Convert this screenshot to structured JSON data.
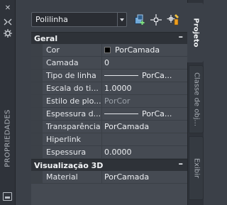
{
  "palette": {
    "title": "PROPRIEDADES"
  },
  "toolbar": {
    "object_type": "Polilinha",
    "buttons": [
      {
        "name": "toggle-pickadd-button",
        "icon": "pickadd-icon"
      },
      {
        "name": "select-objects-button",
        "icon": "crosshair-icon"
      },
      {
        "name": "quick-select-button",
        "icon": "quick-select-icon"
      }
    ]
  },
  "grid": {
    "sections": [
      {
        "title": "Geral",
        "toggle": "–",
        "rows": [
          {
            "name": "Cor",
            "value": "PorCamada",
            "swatch": "#000000"
          },
          {
            "name": "Camada",
            "value": "0"
          },
          {
            "name": "Tipo de linha",
            "value": "PorCa..."
          },
          {
            "name": "Escala do ti...",
            "value": "1.0000"
          },
          {
            "name": "Estilo de plo...",
            "value": "PorCor"
          },
          {
            "name": "Espessura d...",
            "value": "PorCa..."
          },
          {
            "name": "Transparência",
            "value": "PorCamada"
          },
          {
            "name": "Hiperlink",
            "value": ""
          },
          {
            "name": "Espessura",
            "value": "0.0000"
          }
        ]
      },
      {
        "title": "Visualização 3D",
        "toggle": "–",
        "rows": [
          {
            "name": "Material",
            "value": "PorCamada"
          }
        ]
      }
    ]
  },
  "tabs": [
    {
      "label": "Projeto",
      "active": true
    },
    {
      "label": "Classe de obj...",
      "active": false
    },
    {
      "label": "Exibir",
      "active": false
    }
  ]
}
